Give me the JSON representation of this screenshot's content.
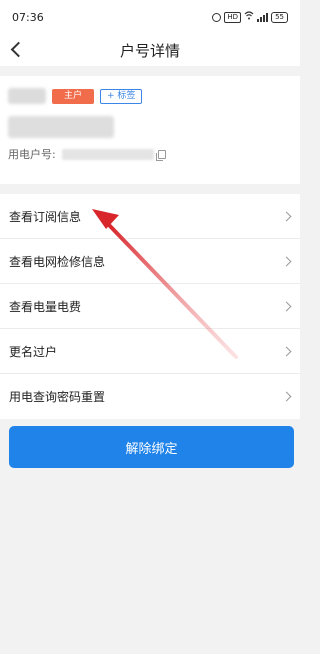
{
  "status_bar": {
    "time": "07:36",
    "icons": [
      "alarm-icon",
      "hd-icon",
      "wifi-icon",
      "signal-icon",
      "battery-icon"
    ],
    "hd_text": "HD",
    "battery_text": "55"
  },
  "nav": {
    "back_icon": "chevron-left-icon",
    "title": "户号详情"
  },
  "account": {
    "owner_tag": "主户",
    "add_tag": "+ 标签",
    "number_label": "用电户号:"
  },
  "menu": {
    "items": [
      {
        "label": "查看订阅信息"
      },
      {
        "label": "查看电网检修信息"
      },
      {
        "label": "查看电量电费"
      },
      {
        "label": "更名过户"
      },
      {
        "label": "用电查询密码重置"
      }
    ]
  },
  "actions": {
    "unbind_label": "解除绑定"
  },
  "colors": {
    "primary": "#1f83ea",
    "owner_tag": "#f06c4b",
    "annotation_arrow": "#d8262b"
  }
}
